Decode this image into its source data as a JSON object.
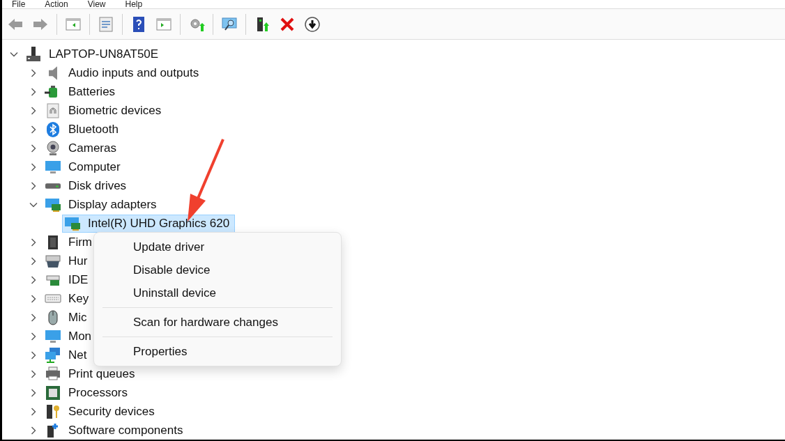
{
  "menu_bar": [
    "File",
    "Action",
    "View",
    "Help"
  ],
  "tree": {
    "label": "LAPTOP-UN8AT50E",
    "expanded": true,
    "selected": false,
    "children": [
      {
        "label": "Audio inputs and outputs",
        "expanded": false,
        "selected": false
      },
      {
        "label": "Batteries",
        "expanded": false,
        "selected": false
      },
      {
        "label": "Biometric devices",
        "expanded": false,
        "selected": false
      },
      {
        "label": "Bluetooth",
        "expanded": false,
        "selected": false
      },
      {
        "label": "Cameras",
        "expanded": false,
        "selected": false
      },
      {
        "label": "Computer",
        "expanded": false,
        "selected": false
      },
      {
        "label": "Disk drives",
        "expanded": false,
        "selected": false
      },
      {
        "label": "Display adapters",
        "expanded": true,
        "selected": false,
        "children": [
          {
            "label": "Intel(R) UHD Graphics 620",
            "selected": true
          }
        ]
      },
      {
        "label": "Firm",
        "expanded": false,
        "selected": false
      },
      {
        "label": "Hur",
        "expanded": false,
        "selected": false
      },
      {
        "label": "IDE",
        "expanded": false,
        "selected": false
      },
      {
        "label": "Key",
        "expanded": false,
        "selected": false
      },
      {
        "label": "Mic",
        "expanded": false,
        "selected": false
      },
      {
        "label": "Mon",
        "expanded": false,
        "selected": false
      },
      {
        "label": "Net",
        "expanded": false,
        "selected": false
      },
      {
        "label": "Print queues",
        "expanded": false,
        "selected": false
      },
      {
        "label": "Processors",
        "expanded": false,
        "selected": false
      },
      {
        "label": "Security devices",
        "expanded": false,
        "selected": false
      },
      {
        "label": "Software components",
        "expanded": false,
        "selected": false
      }
    ]
  },
  "context_menu": {
    "items": [
      {
        "kind": "item",
        "label": "Update driver"
      },
      {
        "kind": "item",
        "label": "Disable device"
      },
      {
        "kind": "item",
        "label": "Uninstall device"
      },
      {
        "kind": "separator"
      },
      {
        "kind": "item",
        "label": "Scan for hardware changes"
      },
      {
        "kind": "separator"
      },
      {
        "kind": "item",
        "label": "Properties"
      }
    ]
  }
}
